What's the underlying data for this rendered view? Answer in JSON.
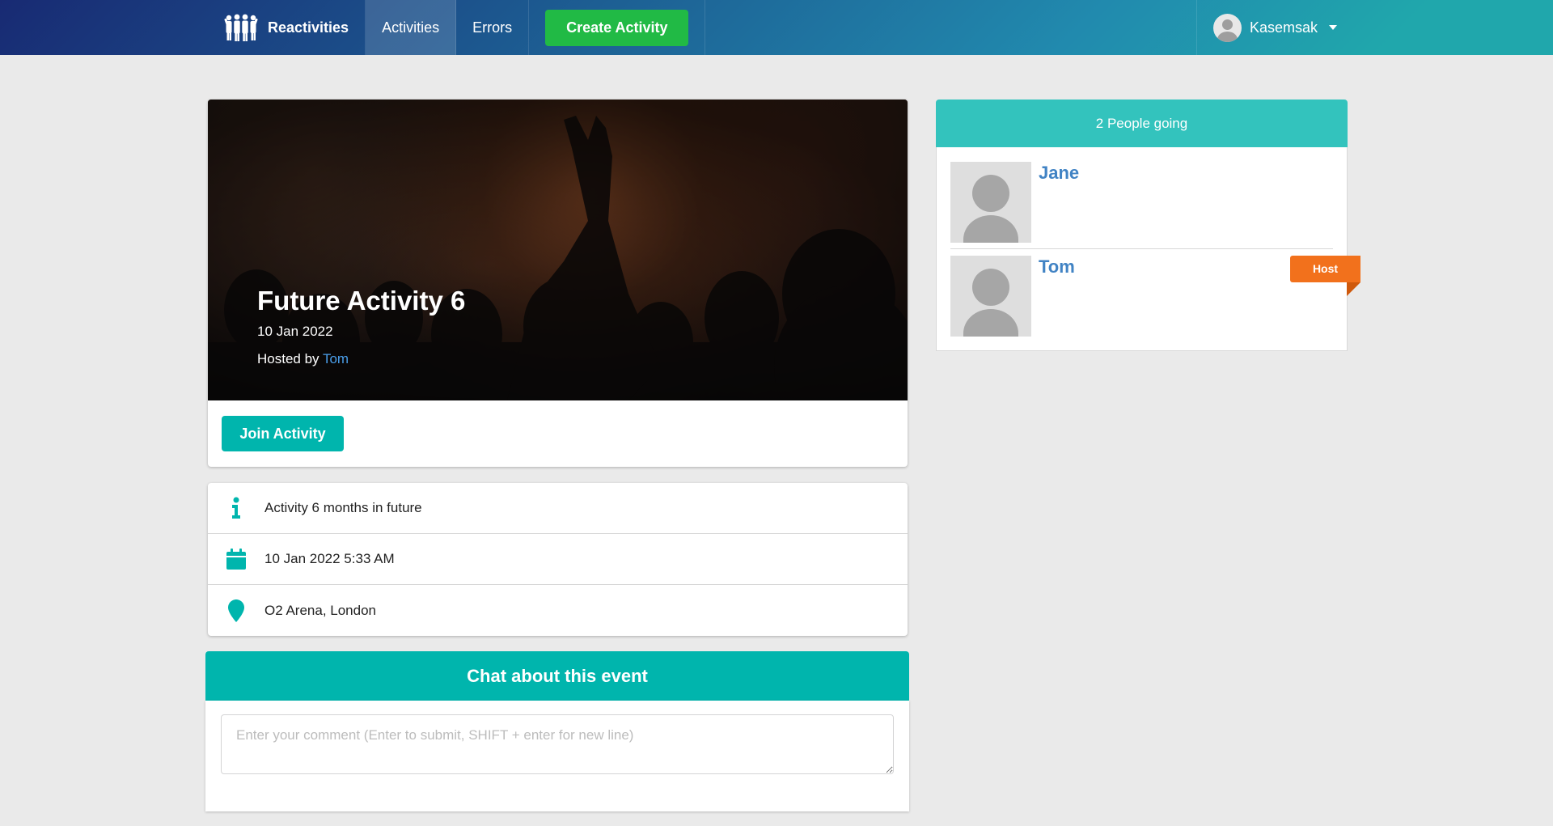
{
  "nav": {
    "brand": "Reactivities",
    "items": [
      {
        "label": "Activities"
      },
      {
        "label": "Errors"
      }
    ],
    "create_button": "Create Activity",
    "user": "Kasemsak"
  },
  "activity": {
    "title": "Future Activity 6",
    "date": "10 Jan 2022",
    "hosted_by_prefix": "Hosted by",
    "host": "Tom",
    "join_button": "Join Activity",
    "description": "Activity 6 months in future",
    "datetime": "10 Jan 2022 5:33 AM",
    "location": "O2 Arena, London"
  },
  "chat": {
    "title": "Chat about this event",
    "placeholder": "Enter your comment (Enter to submit, SHIFT + enter for new line)"
  },
  "attendees": {
    "header": "2 People going",
    "people": [
      {
        "name": "Jane"
      },
      {
        "name": "Tom"
      }
    ],
    "host_label": "Host"
  },
  "colors": {
    "teal": "#00b5ad",
    "green": "#21ba45",
    "orange": "#f2711c",
    "link": "#4183c4"
  },
  "icons": {
    "brand": "group-icon",
    "info": "info-icon",
    "calendar": "calendar-icon",
    "location": "map-marker-icon",
    "caret": "dropdown-caret-icon"
  }
}
